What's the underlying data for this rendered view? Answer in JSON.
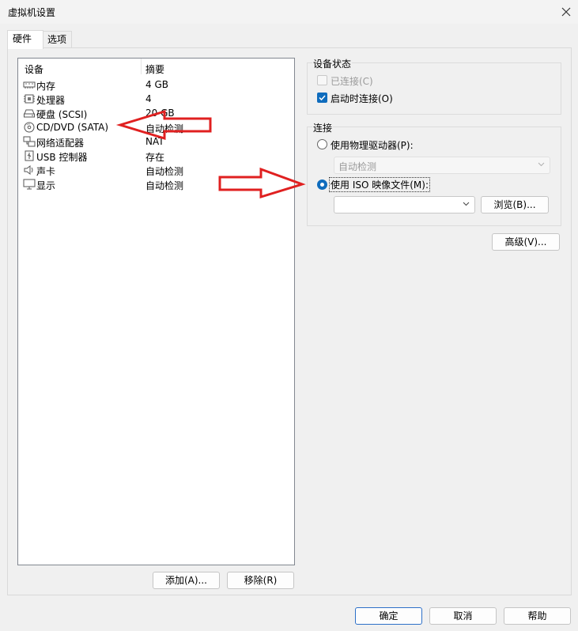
{
  "window": {
    "title": "虚拟机设置"
  },
  "tabs": [
    {
      "label": "硬件",
      "active": true
    },
    {
      "label": "选项",
      "active": false
    }
  ],
  "device_table": {
    "headers": {
      "device": "设备",
      "summary": "摘要"
    },
    "rows": [
      {
        "name": "内存",
        "summary": "4 GB",
        "icon": "memory-icon"
      },
      {
        "name": "处理器",
        "summary": "4",
        "icon": "processor-icon"
      },
      {
        "name": "硬盘 (SCSI)",
        "summary": "20 GB",
        "icon": "hard-disk-icon"
      },
      {
        "name": "CD/DVD (SATA)",
        "summary": "自动检测",
        "icon": "cd-dvd-icon"
      },
      {
        "name": "网络适配器",
        "summary": "NAT",
        "icon": "network-adapter-icon"
      },
      {
        "name": "USB 控制器",
        "summary": "存在",
        "icon": "usb-icon"
      },
      {
        "name": "声卡",
        "summary": "自动检测",
        "icon": "speaker-icon"
      },
      {
        "name": "显示",
        "summary": "自动检测",
        "icon": "display-icon"
      }
    ]
  },
  "left_buttons": {
    "add": "添加(A)...",
    "remove": "移除(R)"
  },
  "device_status": {
    "title": "设备状态",
    "connected": {
      "label": "已连接(C)",
      "checked": false,
      "enabled": false
    },
    "connect_at_power_on": {
      "label": "启动时连接(O)",
      "checked": true
    }
  },
  "connection": {
    "title": "连接",
    "physical_drive": {
      "label": "使用物理驱动器(P):",
      "selected": false
    },
    "physical_drive_select": {
      "value": "自动检测"
    },
    "iso_image": {
      "label": "使用 ISO 映像文件(M):",
      "selected": true
    },
    "iso_path": {
      "value": ""
    },
    "browse_button": "浏览(B)..."
  },
  "advanced_button": "高级(V)...",
  "footer": {
    "ok": "确定",
    "cancel": "取消",
    "help": "帮助"
  },
  "colors": {
    "accent": "#0f6cbd",
    "annotation_arrow": "#e02020"
  }
}
